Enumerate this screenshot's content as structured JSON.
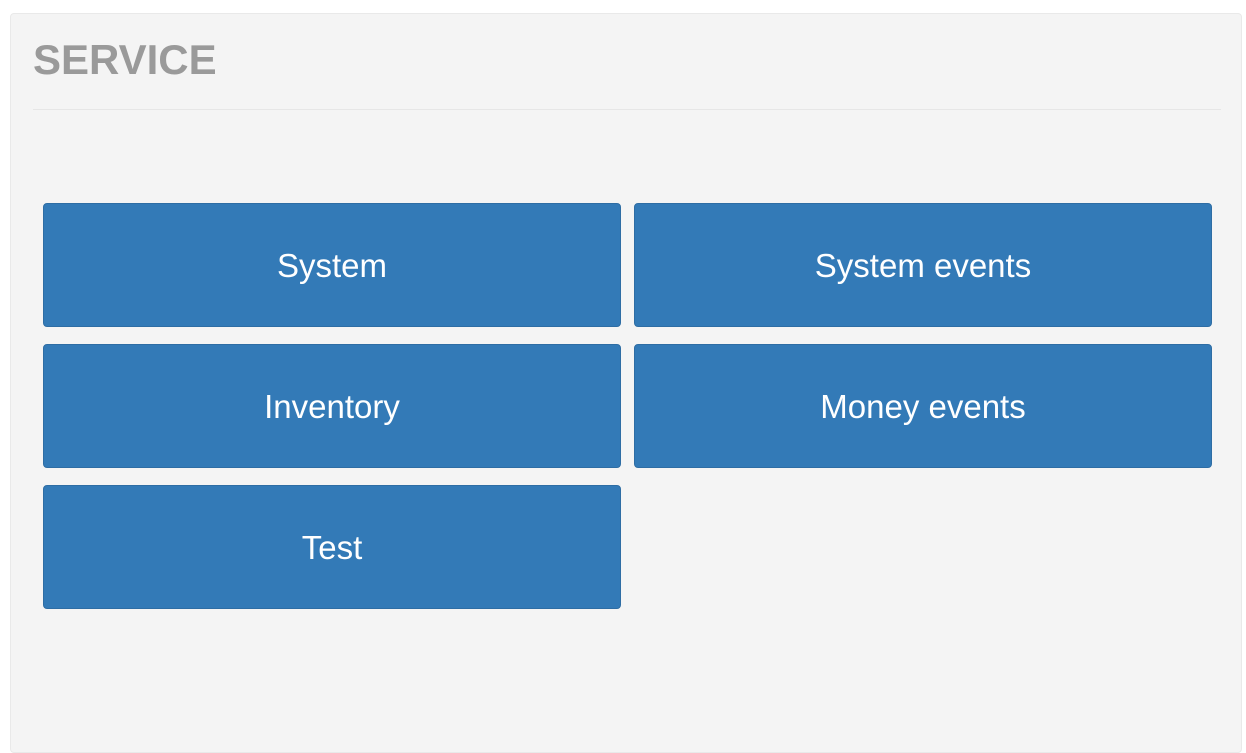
{
  "panel": {
    "title": "SERVICE"
  },
  "buttons": {
    "system": "System",
    "system_events": "System events",
    "inventory": "Inventory",
    "money_events": "Money events",
    "test": "Test"
  },
  "colors": {
    "button_bg": "#337ab7",
    "button_text": "#ffffff",
    "panel_bg": "#f4f4f4",
    "title_text": "#9a9a9a"
  }
}
